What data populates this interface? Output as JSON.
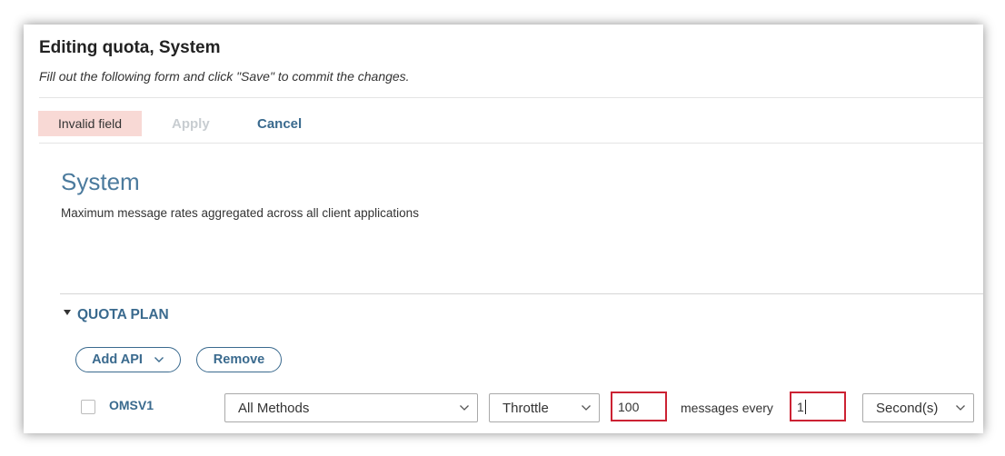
{
  "header": {
    "title": "Editing quota, System",
    "subtitle": "Fill out the following form and click \"Save\" to commit the changes."
  },
  "toolbar": {
    "invalid_label": "Invalid field",
    "apply_label": "Apply",
    "cancel_label": "Cancel"
  },
  "section": {
    "title": "System",
    "description": "Maximum message rates aggregated across all client applications"
  },
  "quota_plan": {
    "header": "QUOTA PLAN",
    "add_api_label": "Add API",
    "remove_label": "Remove",
    "row": {
      "api_name": "OMSV1",
      "method": "All Methods",
      "policy": "Throttle",
      "message_count": "100",
      "messages_every_label": "messages every",
      "period": "1",
      "unit": "Second(s)"
    }
  },
  "colors": {
    "accent": "#3a6a8e",
    "invalid_bg": "#f8d9d5",
    "error_border": "#cc2233",
    "disabled_text": "#c8cdd1"
  },
  "icons": {
    "collapse": "triangle-down-icon",
    "dropdown": "chevron-down-icon"
  }
}
